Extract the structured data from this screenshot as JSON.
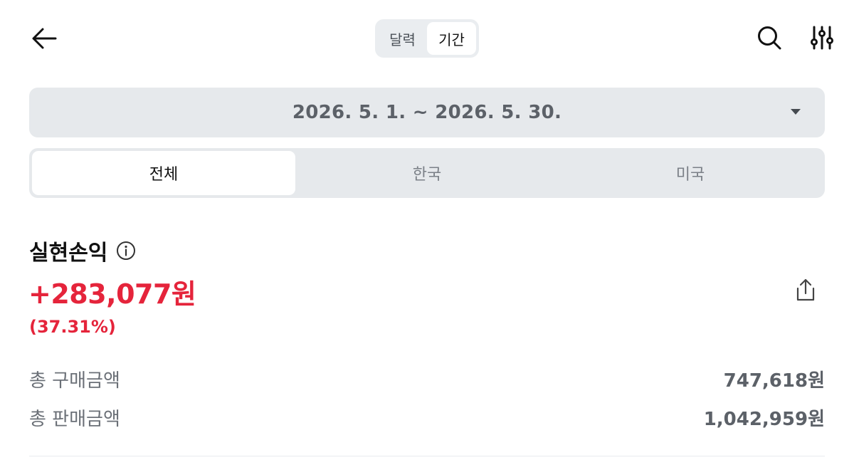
{
  "header": {
    "view_toggle": {
      "options": [
        "달력",
        "기간"
      ],
      "selected": "기간"
    },
    "icons": {
      "back": "back-arrow-icon",
      "search": "search-icon",
      "filter": "filter-sliders-icon"
    }
  },
  "date_range": {
    "label": "2026. 5. 1. ~ 2026. 5. 30."
  },
  "market_tabs": {
    "items": [
      "전체",
      "한국",
      "미국"
    ],
    "selected": "전체"
  },
  "realized_pl": {
    "title": "실현손익",
    "amount": "+283,077원",
    "rate": "(37.31%)"
  },
  "totals": {
    "purchase_label": "총 구매금액",
    "purchase_value": "747,618원",
    "sale_label": "총 판매금액",
    "sale_value": "1,042,959원"
  },
  "colors": {
    "profit": "#e5243b",
    "panel_bg": "#e6e9ec"
  }
}
